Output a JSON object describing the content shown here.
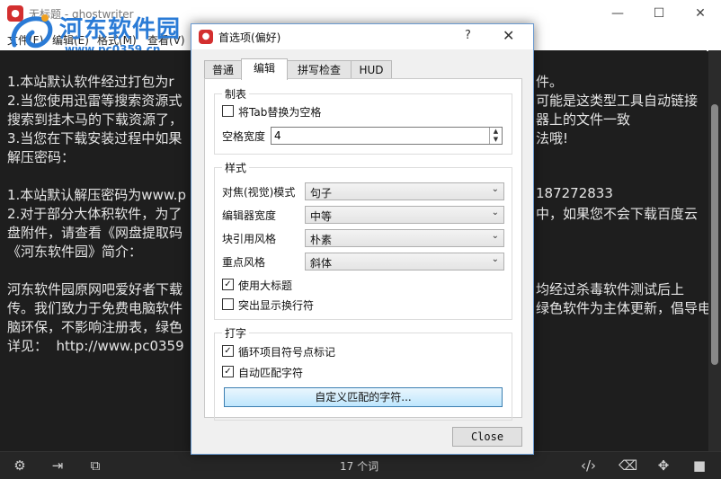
{
  "main_window": {
    "title": "无标题 - ghostwriter",
    "menu": [
      "文件(F)",
      "编辑(E)",
      "格式(M)",
      "查看(V)"
    ],
    "watermark": {
      "text": "河东软件园",
      "url": "www.pc0359.cn"
    },
    "editor_lines": [
      "1.本站默认软件经过打包为r",
      "2.当您使用迅雷等搜索资源式",
      "搜索到挂木马的下载资源了，",
      "3.当您在下载安装过程中如果",
      "解压密码：",
      "",
      "1.本站默认解压密码为www.p",
      "2.对于部分大体积软件，为了",
      "盘附件，请查看《网盘提取码",
      "《河东软件园》简介：",
      "",
      "河东软件园原网吧爱好者下载",
      "传。我们致力于免费电脑软件",
      "脑环保，不影响注册表，绿色",
      "详见：  http://www.pc0359"
    ],
    "editor_lines_right": [
      {
        "row": 0,
        "text": "件。"
      },
      {
        "row": 1,
        "text": "可能是这类型工具自动链接"
      },
      {
        "row": 2,
        "text": "器上的文件一致"
      },
      {
        "row": 3,
        "text": "法哦!"
      },
      {
        "row": 6,
        "text": "187272833"
      },
      {
        "row": 7,
        "text": "中，如果您不会下载百度云"
      },
      {
        "row": 11,
        "text": "均经过杀毒软件测试后上"
      },
      {
        "row": 12,
        "text": "绿色软件为主体更新，倡导电"
      }
    ],
    "status": {
      "word_count": "17 个词"
    }
  },
  "dialog": {
    "title": "首选项(偏好)",
    "help": "?",
    "close_glyph": "✕",
    "tabs": [
      "普通",
      "编辑",
      "拼写检查",
      "HUD"
    ],
    "active_tab": "编辑",
    "groups": {
      "tabs_group": {
        "title": "制表",
        "replace_tab_label": "将Tab替换为空格",
        "replace_tab_checked": false,
        "space_width_label": "空格宽度",
        "space_width_value": "4"
      },
      "style_group": {
        "title": "样式",
        "focus_mode_label": "对焦(视觉)模式",
        "focus_mode_value": "句子",
        "editor_width_label": "编辑器宽度",
        "editor_width_value": "中等",
        "blockquote_label": "块引用风格",
        "blockquote_value": "朴素",
        "emphasis_label": "重点风格",
        "emphasis_value": "斜体",
        "large_headings_label": "使用大标题",
        "large_headings_checked": true,
        "highlight_linebreak_label": "突出显示换行符",
        "highlight_linebreak_checked": false
      },
      "typing_group": {
        "title": "打字",
        "cycle_bullets_label": "循环项目符号点标记",
        "cycle_bullets_checked": true,
        "auto_match_label": "自动匹配字符",
        "auto_match_checked": true,
        "custom_match_button": "自定义匹配的字符..."
      }
    },
    "close_button": "Close"
  }
}
